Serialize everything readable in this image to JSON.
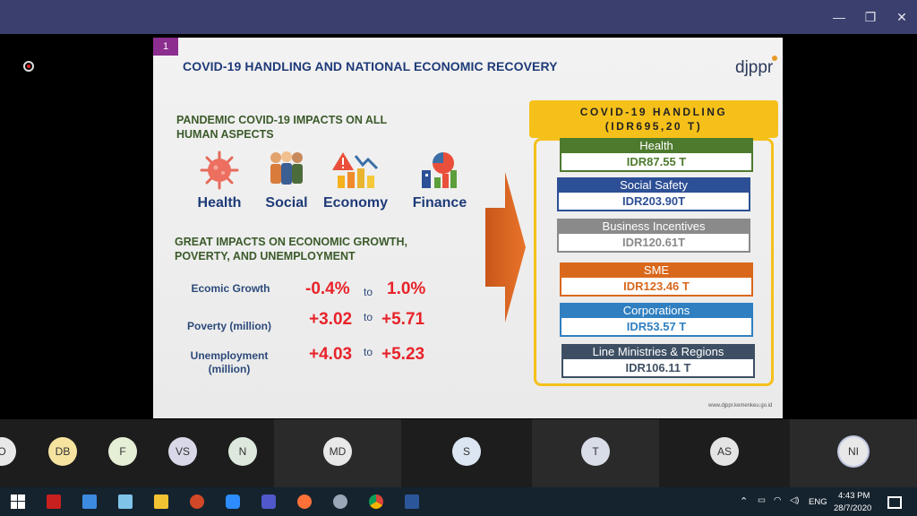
{
  "window": {
    "controls": [
      "—",
      "❐",
      "✕"
    ]
  },
  "slide": {
    "number": "1",
    "title": "COVID-19 HANDLING AND NATIONAL ECONOMIC RECOVERY",
    "brand": "djppr",
    "section1": [
      "PANDEMIC COVID-19 IMPACTS ON ALL",
      "HUMAN ASPECTS"
    ],
    "impacts": [
      "Health",
      "Social",
      "Economy",
      "Finance"
    ],
    "section2": [
      "GREAT IMPACTS ON ECONOMIC GROWTH,",
      "POVERTY, AND UNEMPLOYMENT"
    ],
    "rows": [
      {
        "label": [
          "Ecomic Growth"
        ],
        "from": "-0.4%",
        "to_word": "to",
        "to": "1.0%"
      },
      {
        "label": [
          "Poverty (million)"
        ],
        "from": "+3.02",
        "to_word": "to",
        "to": "+5.71"
      },
      {
        "label": [
          "Unemployment",
          "(million)"
        ],
        "from": "+4.03",
        "to_word": "to",
        "to": "+5.23"
      }
    ],
    "handling": {
      "title": "COVID-19 HANDLING",
      "total": "(IDR695,20 T)",
      "items": [
        {
          "label": "Health",
          "amount": "IDR87.55 T",
          "color": "#4e7a2e"
        },
        {
          "label": "Social Safety",
          "amount": "IDR203.90T",
          "color": "#2d4f95"
        },
        {
          "label": "Business Incentives",
          "amount": "IDR120.61T",
          "color": "#8a8a8a"
        },
        {
          "label": "SME",
          "amount": "IDR123.46 T",
          "color": "#d9681c"
        },
        {
          "label": "Corporations",
          "amount": "IDR53.57 T",
          "color": "#2f7fc1"
        },
        {
          "label": "Line Ministries & Regions",
          "amount": "IDR106.11 T",
          "color": "#3e4f63"
        }
      ]
    },
    "url": "www.djppr.kemenkeu.go.id"
  },
  "participants": [
    "O",
    "DB",
    "F",
    "VS",
    "N",
    "MD",
    "S",
    "T",
    "AS",
    "NI"
  ],
  "taskbar": {
    "apps": [
      "windows-start-icon",
      "acrobat-icon",
      "store-icon",
      "notes-icon",
      "file-explorer-icon",
      "powerpoint-icon",
      "zoom-icon",
      "teams-icon",
      "firefox-icon",
      "paint-icon",
      "chrome-icon",
      "word-icon"
    ],
    "lang": "ENG",
    "time": "4:43 PM",
    "date": "28/7/2020"
  }
}
